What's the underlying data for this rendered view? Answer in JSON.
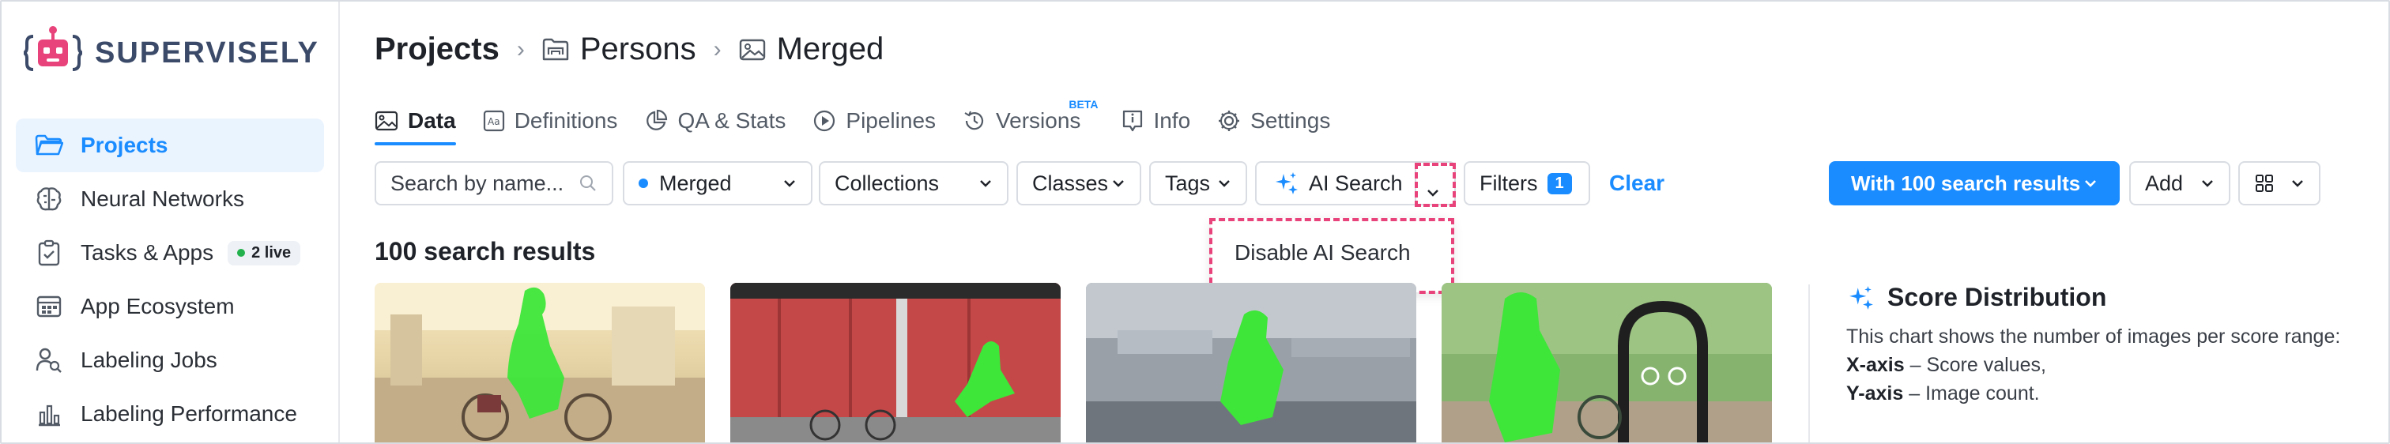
{
  "brand": {
    "name": "SUPERVISELY"
  },
  "sidebar": {
    "items": [
      {
        "label": "Projects",
        "icon": "folder-icon",
        "active": true
      },
      {
        "label": "Neural Networks",
        "icon": "brain-icon"
      },
      {
        "label": "Tasks & Apps",
        "icon": "clipboard-icon",
        "badge": "2 live"
      },
      {
        "label": "App Ecosystem",
        "icon": "app-window-icon"
      },
      {
        "label": "Labeling Jobs",
        "icon": "users-icon"
      },
      {
        "label": "Labeling Performance",
        "icon": "bar-chart-icon"
      }
    ]
  },
  "breadcrumb": {
    "root": "Projects",
    "project": "Persons",
    "dataset": "Merged"
  },
  "tabs": [
    {
      "label": "Data",
      "icon": "image-icon",
      "active": true
    },
    {
      "label": "Definitions",
      "icon": "definitions-icon"
    },
    {
      "label": "QA & Stats",
      "icon": "pie-chart-icon"
    },
    {
      "label": "Pipelines",
      "icon": "play-circle-icon"
    },
    {
      "label": "Versions",
      "icon": "history-icon",
      "tag": "BETA"
    },
    {
      "label": "Info",
      "icon": "info-icon"
    },
    {
      "label": "Settings",
      "icon": "gear-icon"
    }
  ],
  "toolbar": {
    "search_placeholder": "Search by name...",
    "dataset_select": "Merged",
    "collections": "Collections",
    "classes": "Classes",
    "tags": "Tags",
    "ai_search": "AI Search",
    "filters": "Filters",
    "filters_count": "1",
    "clear": "Clear",
    "results_button": "With 100 search results",
    "add": "Add"
  },
  "ai_dropdown": {
    "item": "Disable AI Search"
  },
  "results": {
    "title": "100 search results"
  },
  "score_panel": {
    "title": "Score Distribution",
    "description": "This chart shows the number of images per score range:",
    "x_label": "X-axis",
    "x_desc": " – Score values,",
    "y_label": "Y-axis",
    "y_desc": " – Image count."
  },
  "colors": {
    "accent": "#1a8cff",
    "brand_pink": "#e8437a",
    "mask_green": "#3ee63a"
  }
}
